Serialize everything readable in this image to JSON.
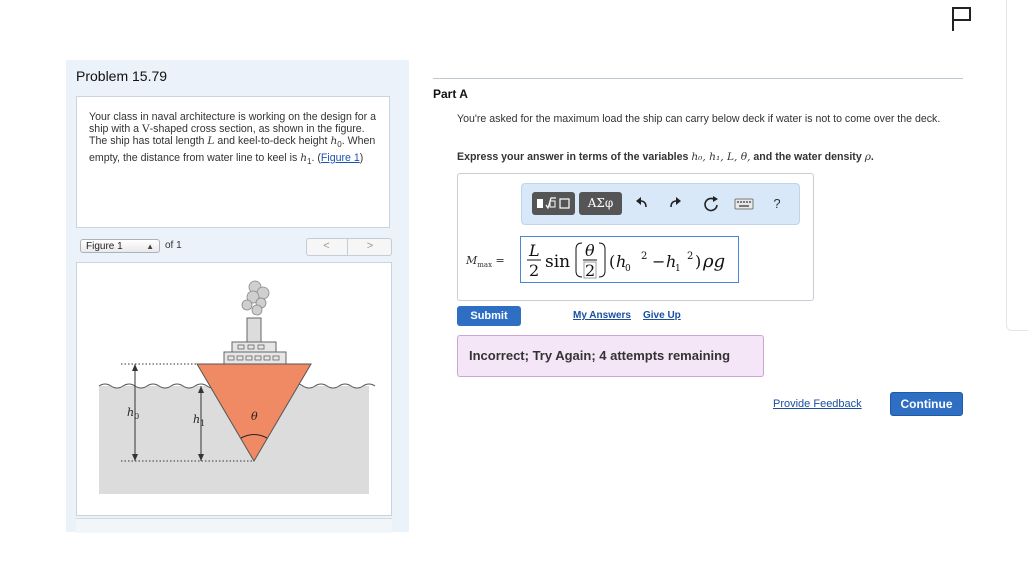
{
  "problem": {
    "title": "Problem 15.79",
    "text_1": "Your class in naval architecture is working on the design for a ship with a ",
    "v_letter": "V",
    "text_2": "-shaped cross section, as shown in the figure. The ship has total length ",
    "L": "L",
    "text_3": " and keel-to-deck height ",
    "h0": "h",
    "h0_sub": "0",
    "text_4": ". When empty, the distance from water line to keel is ",
    "h1": "h",
    "h1_sub": "1",
    "text_5": ". (",
    "figure_link": "Figure 1",
    "text_6": ")"
  },
  "figure": {
    "select_value": "Figure 1",
    "of_label": "of 1",
    "prev": "<",
    "next": ">",
    "labels": {
      "h0": "h",
      "h0_sub": "0",
      "h1": "h",
      "h1_sub": "1",
      "theta": "θ"
    }
  },
  "part": {
    "title": "Part A",
    "question": "You're asked for the maximum load the ship can carry below deck if water is not to come over the deck.",
    "instruction_prefix": "Express your answer in terms of the variables ",
    "instruction_vars": "h₀, h₁, L, θ,",
    "instruction_mid": " and the water density ",
    "instruction_rho": "ρ",
    "instruction_end": "."
  },
  "editor": {
    "symbols_label": "ΑΣφ",
    "help_label": "?",
    "answer_label_var": "M",
    "answer_label_sub": "max",
    "answer_label_eq": " =",
    "answer": {
      "frac_num": "L",
      "frac_den": "2",
      "func": "sin",
      "theta": "θ",
      "theta_den": "2",
      "h": "h",
      "sub0": "0",
      "sub1": "1",
      "sq": "2",
      "minus": "−",
      "rho_g": "ρg"
    }
  },
  "actions": {
    "submit": "Submit",
    "my_answers": "My Answers",
    "give_up": "Give Up",
    "feedback": "Incorrect; Try Again; 4 attempts remaining",
    "provide_feedback": "Provide Feedback",
    "continue": "Continue"
  },
  "colors": {
    "accent": "#2e6fc4",
    "hull": "#f08a64",
    "water": "#dcdcdc",
    "feedback_bg": "#f4e6f7"
  },
  "icons": [
    "flag-icon",
    "templates-icon",
    "undo-icon",
    "redo-icon",
    "reset-icon",
    "keyboard-icon"
  ]
}
